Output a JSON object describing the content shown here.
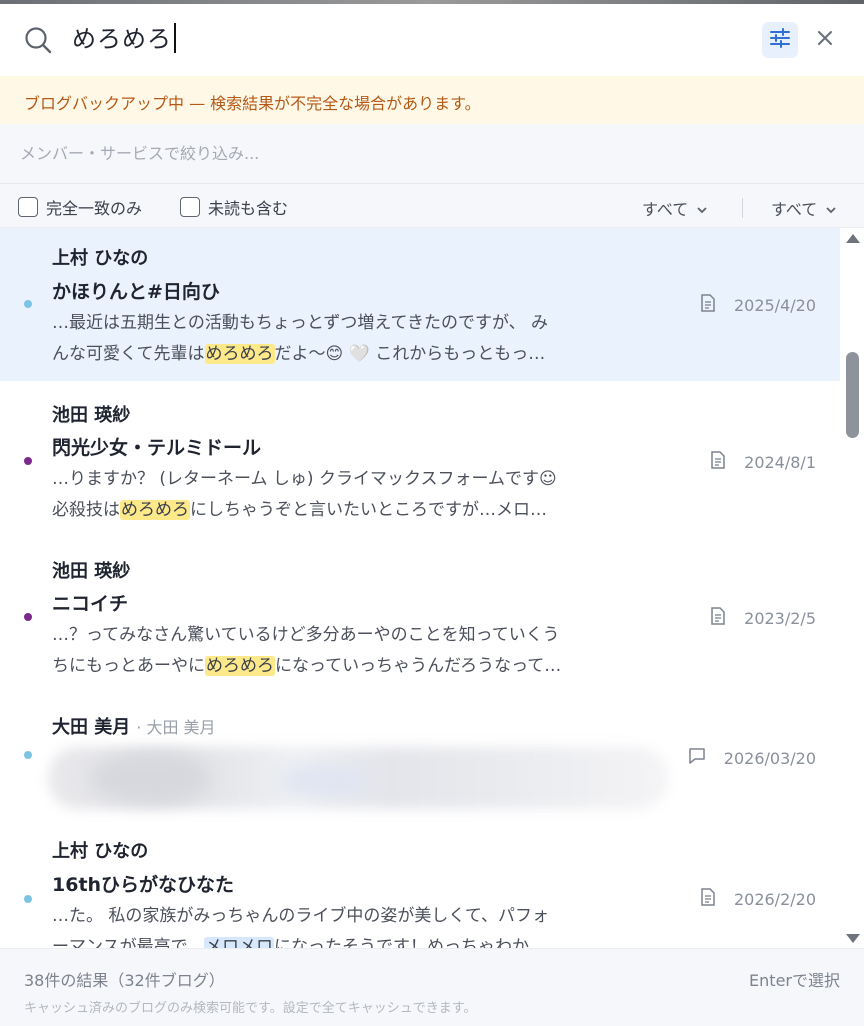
{
  "search": {
    "query": "めろめろ"
  },
  "banner": {
    "text": "ブログバックアップ中 — 検索結果が不完全な場合があります。"
  },
  "filters": {
    "member_placeholder": "メンバー・サービスで絞り込み...",
    "exact_match_label": "完全一致のみ",
    "include_unread_label": "未読も含む",
    "dropdown1_value": "すべて",
    "dropdown2_value": "すべて"
  },
  "results": [
    {
      "author": "上村 ひなの",
      "title": "かほりんと#日向ひ",
      "snippet_line1": "…最近は五期生との活動もちょっとずつ増えてきたのですが、 み",
      "snippet_line2_pre": "んな可愛くて先輩は",
      "highlight": "めろめろ",
      "snippet_line2_post": "だよ〜😊 🤍 これからもっともっ…",
      "date": "2025/4/20",
      "type_icon": "document-icon",
      "dot_color": "#7cc3e6",
      "selected": true
    },
    {
      "author": "池田 瑛紗",
      "title": "閃光少女・テルミドール",
      "snippet_line1": "…りますか？ (レターネーム しゅ) クライマックスフォームです☺",
      "snippet_line2_pre": "必殺技は",
      "highlight": "めろめろ",
      "snippet_line2_post": "にしちゃうぞと言いたいところですが…メロ…",
      "date": "2024/8/1",
      "type_icon": "document-icon",
      "dot_color": "#7b2a8c"
    },
    {
      "author": "池田 瑛紗",
      "title": "ニコイチ",
      "snippet_line1": "…？ってみなさん驚いているけど多分あーやのことを知っていくう",
      "snippet_line2_pre": "ちにもっとあーやに",
      "highlight": "めろめろ",
      "snippet_line2_post": "になっていっちゃうんだろうなって…",
      "date": "2023/2/5",
      "type_icon": "document-icon",
      "dot_color": "#7b2a8c"
    },
    {
      "author": "大田 美月",
      "author_sub": "大田 美月",
      "date": "2026/03/20",
      "type_icon": "chat-bubble-icon",
      "dot_color": "#7cc3e6"
    },
    {
      "author": "上村 ひなの",
      "title": "16thひらがなひなた",
      "snippet_line1": "…た。 私の家族がみっちゃんのライブ中の姿が美しくて、パフォ",
      "snippet_line2_pre": "ーマンスが最高で、",
      "highlight": "メロメロ",
      "snippet_line2_post": "になったそうです！めっちゃわか…",
      "date": "2026/2/20",
      "type_icon": "document-icon",
      "dot_color": "#7cc3e6"
    }
  ],
  "footer": {
    "count": "38件の結果（32件ブログ）",
    "enter_hint": "Enterで選択",
    "note": "キャッシュ済みのブログのみ検索可能です。設定で全てキャッシュできます。"
  },
  "colors": {
    "accent": "#2f6fd6",
    "banner_bg": "#fff8e6",
    "banner_text": "#b45a16",
    "highlight": "#fde88a",
    "selected_row": "#eaf3fd"
  }
}
